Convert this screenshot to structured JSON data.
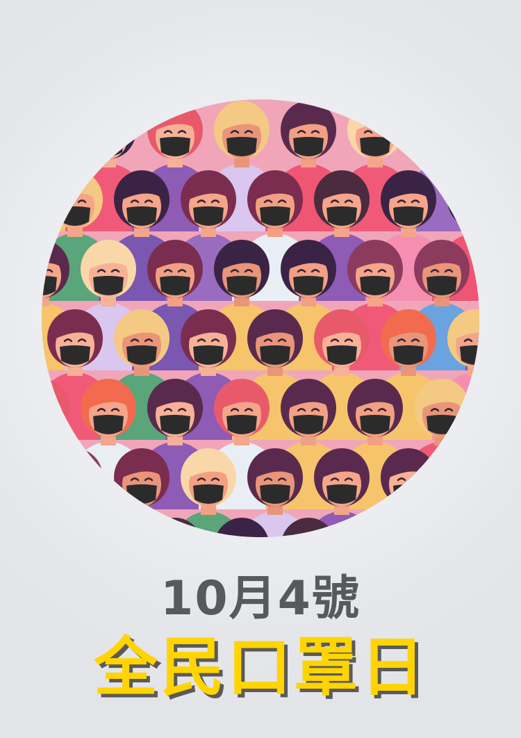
{
  "poster": {
    "date_line": "10月4號",
    "headline": "全民口罩日"
  },
  "illustration": {
    "description_icon": "crowd-wearing-masks-illustration",
    "mask_color": "#2b2b2b"
  },
  "colors": {
    "background": "#e9ebee",
    "date_text": "#58595b",
    "headline_fill": "#ffd400",
    "headline_shadow": "#5a5a5a"
  }
}
